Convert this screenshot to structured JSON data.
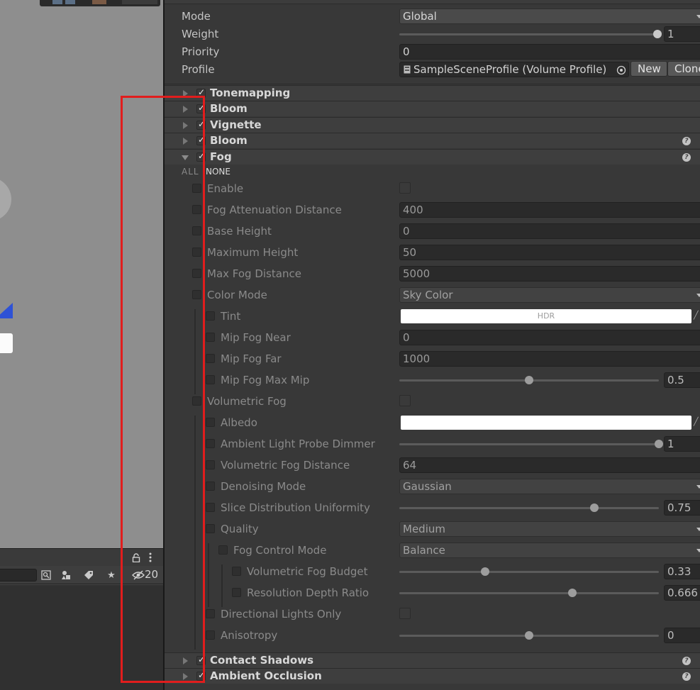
{
  "hierarchy": {
    "hidden_count": "20"
  },
  "volume": {
    "mode_label": "Mode",
    "mode_value": "Global",
    "weight_label": "Weight",
    "weight_value": "1",
    "priority_label": "Priority",
    "priority_value": "0",
    "profile_label": "Profile",
    "profile_value": "SampleSceneProfile (Volume Profile)",
    "new_label": "New",
    "clone_label": "Clone"
  },
  "components_top": [
    {
      "title": "Tonemapping"
    },
    {
      "title": "Bloom"
    },
    {
      "title": "Vignette"
    },
    {
      "title": "Bloom"
    },
    {
      "title": "Fog"
    }
  ],
  "fog": {
    "all_label": "ALL",
    "none_label": "NONE",
    "enable_label": "Enable",
    "attenuation_label": "Fog Attenuation Distance",
    "attenuation_value": "400",
    "base_height_label": "Base Height",
    "base_height_value": "0",
    "max_height_label": "Maximum Height",
    "max_height_value": "50",
    "max_distance_label": "Max Fog Distance",
    "max_distance_value": "5000",
    "color_mode_label": "Color Mode",
    "color_mode_value": "Sky Color",
    "tint_label": "Tint",
    "tint_hdr": "HDR",
    "tint_color": "#ffffff",
    "mip_near_label": "Mip Fog Near",
    "mip_near_value": "0",
    "mip_far_label": "Mip Fog Far",
    "mip_far_value": "1000",
    "mip_max_label": "Mip Fog Max Mip",
    "mip_max_value": "0.5",
    "mip_max_fraction": 0.5,
    "vol_fog_label": "Volumetric Fog",
    "albedo_label": "Albedo",
    "albedo_color": "#ffffff",
    "probe_dimmer_label": "Ambient Light Probe Dimmer",
    "probe_dimmer_value": "1",
    "probe_dimmer_fraction": 1.0,
    "vol_distance_label": "Volumetric Fog Distance",
    "vol_distance_value": "64",
    "denoising_label": "Denoising Mode",
    "denoising_value": "Gaussian",
    "slice_label": "Slice Distribution Uniformity",
    "slice_value": "0.75",
    "slice_fraction": 0.75,
    "quality_label": "Quality",
    "quality_value": "Medium",
    "control_label": "Fog Control Mode",
    "control_value": "Balance",
    "budget_label": "Volumetric Fog Budget",
    "budget_value": "0.33",
    "budget_fraction": 0.33,
    "depth_ratio_label": "Resolution Depth Ratio",
    "depth_ratio_value": "0.666",
    "depth_ratio_fraction": 0.666,
    "dir_lights_label": "Directional Lights Only",
    "anisotropy_label": "Anisotropy",
    "anisotropy_value": "0",
    "anisotropy_fraction": 0.5
  },
  "components_bottom": [
    {
      "title": "Contact Shadows"
    },
    {
      "title": "Ambient Occlusion"
    }
  ],
  "colors": {
    "annotation": "#e11d1d",
    "accent_blue": "#2e52d6"
  }
}
